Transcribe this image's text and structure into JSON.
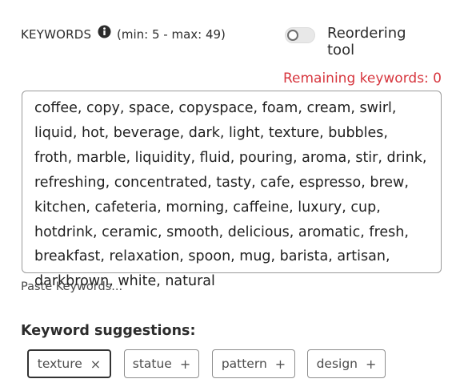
{
  "header": {
    "title": "KEYWORDS",
    "info_icon": "info-icon",
    "range": "(min: 5 - max: 49)",
    "reordering_label": "Reordering tool",
    "reordering_enabled": false
  },
  "remaining": "Remaining keywords: 0",
  "keywords_text": "coffee, copy, space, copyspace, foam, cream, swirl, liquid, hot, beverage, dark, light, texture, bubbles, froth, marble, liquidity, fluid, pouring, aroma, stir, drink, refreshing, concentrated, tasty, cafe, espresso, brew, kitchen, cafeteria, morning, caffeine, luxury, cup, hotdrink, ceramic, smooth, delicious, aromatic, fresh, breakfast, relaxation, spoon, mug, barista, artisan, darkbrown, white, natural",
  "paste_link": "Paste Keywords...",
  "suggestions": {
    "title": "Keyword suggestions:",
    "chips": [
      {
        "label": "texture",
        "symbol": "×",
        "selected": true
      },
      {
        "label": "statue",
        "symbol": "+",
        "selected": false
      },
      {
        "label": "pattern",
        "symbol": "+",
        "selected": false
      },
      {
        "label": "design",
        "symbol": "+",
        "selected": false
      }
    ]
  },
  "colors": {
    "remaining": "#d7373f",
    "text": "#2c2c2c",
    "border": "#9a9a9a"
  }
}
